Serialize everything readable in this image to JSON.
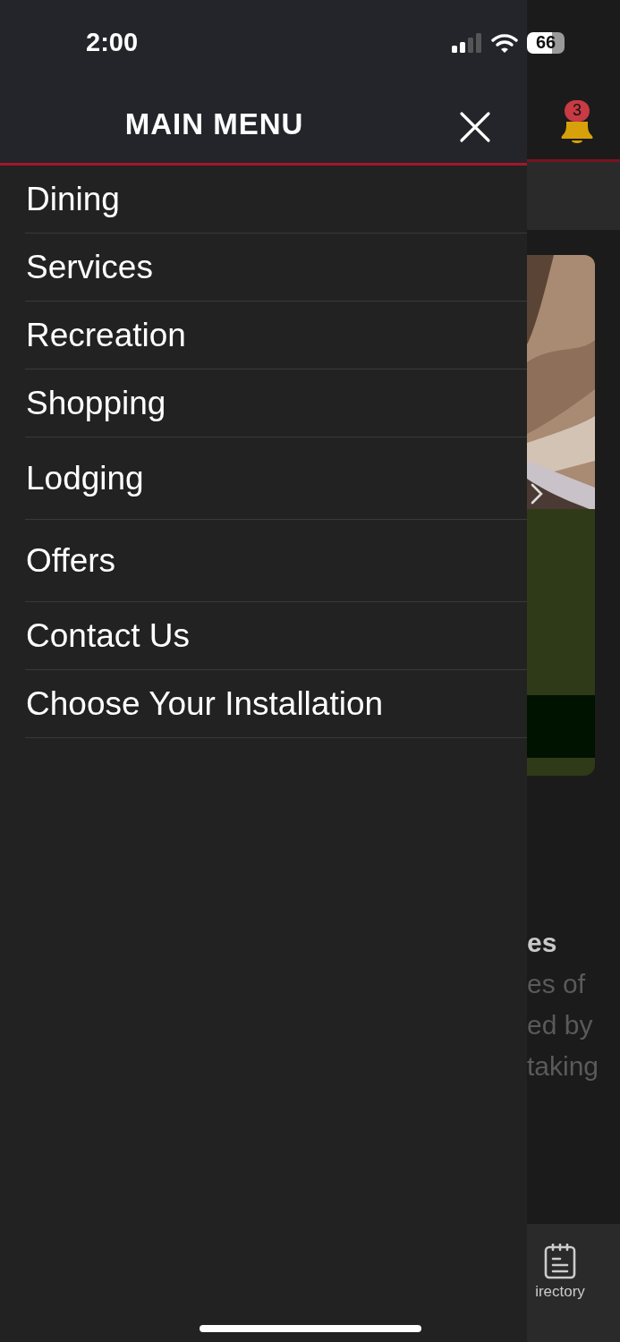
{
  "status_bar": {
    "time": "2:00",
    "battery": "66"
  },
  "menu": {
    "title": "MAIN MENU",
    "items": [
      "Dining",
      "Services",
      "Recreation",
      "Shopping",
      "Lodging",
      "Offers",
      "Contact Us",
      "Choose Your Installation"
    ]
  },
  "notifications": {
    "count": "3"
  },
  "background": {
    "text_lines": [
      "es",
      "es of",
      "ed by",
      "taking"
    ],
    "tab": {
      "label": "irectory"
    }
  }
}
